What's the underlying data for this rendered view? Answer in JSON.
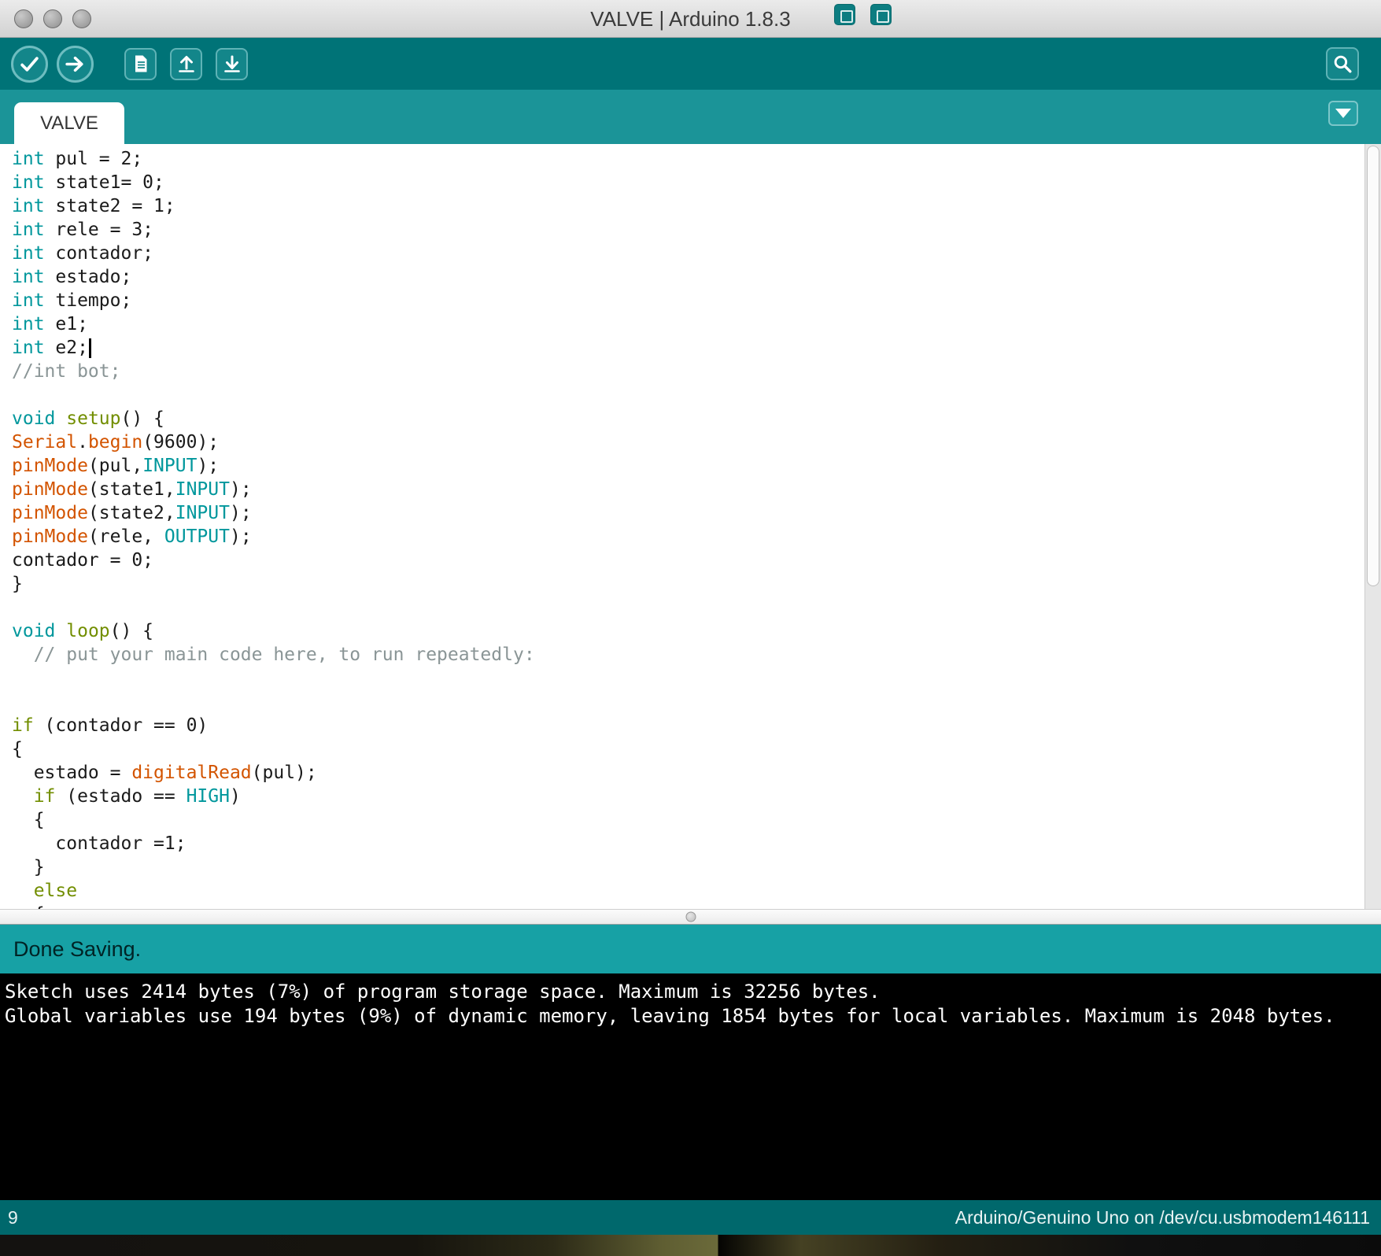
{
  "window": {
    "title": "VALVE | Arduino 1.8.3",
    "traffic_lights": [
      "close",
      "minimize",
      "zoom"
    ]
  },
  "toolbar": {
    "buttons": [
      {
        "label": "Verify",
        "icon": "check-icon"
      },
      {
        "label": "Upload",
        "icon": "arrow-right-icon"
      },
      {
        "label": "New",
        "icon": "document-icon"
      },
      {
        "label": "Open",
        "icon": "arrow-up-icon"
      },
      {
        "label": "Save",
        "icon": "arrow-down-icon"
      }
    ],
    "serial_monitor": {
      "label": "Serial Monitor",
      "icon": "magnifier-icon"
    }
  },
  "tabs": {
    "active": "VALVE",
    "menu_icon": "chevron-down-icon"
  },
  "editor": {
    "caret_line": 9,
    "lines": [
      [
        [
          "k1",
          "int"
        ],
        [
          "pl",
          " pul = 2;"
        ]
      ],
      [
        [
          "k1",
          "int"
        ],
        [
          "pl",
          " state1= 0;"
        ]
      ],
      [
        [
          "k1",
          "int"
        ],
        [
          "pl",
          " state2 = 1;"
        ]
      ],
      [
        [
          "k1",
          "int"
        ],
        [
          "pl",
          " rele = 3;"
        ]
      ],
      [
        [
          "k1",
          "int"
        ],
        [
          "pl",
          " contador;"
        ]
      ],
      [
        [
          "k1",
          "int"
        ],
        [
          "pl",
          " estado;"
        ]
      ],
      [
        [
          "k1",
          "int"
        ],
        [
          "pl",
          " tiempo;"
        ]
      ],
      [
        [
          "k1",
          "int"
        ],
        [
          "pl",
          " e1;"
        ]
      ],
      [
        [
          "k1",
          "int"
        ],
        [
          "pl",
          " e2;"
        ],
        [
          "caret",
          ""
        ]
      ],
      [
        [
          "com",
          "//int bot;"
        ]
      ],
      [],
      [
        [
          "k1",
          "void"
        ],
        [
          "pl",
          " "
        ],
        [
          "k3",
          "setup"
        ],
        [
          "pl",
          "() {"
        ]
      ],
      [
        [
          "k2",
          "Serial"
        ],
        [
          "pl",
          "."
        ],
        [
          "k2",
          "begin"
        ],
        [
          "pl",
          "(9600);"
        ]
      ],
      [
        [
          "k2",
          "pinMode"
        ],
        [
          "pl",
          "(pul,"
        ],
        [
          "k1",
          "INPUT"
        ],
        [
          "pl",
          ");"
        ]
      ],
      [
        [
          "k2",
          "pinMode"
        ],
        [
          "pl",
          "(state1,"
        ],
        [
          "k1",
          "INPUT"
        ],
        [
          "pl",
          ");"
        ]
      ],
      [
        [
          "k2",
          "pinMode"
        ],
        [
          "pl",
          "(state2,"
        ],
        [
          "k1",
          "INPUT"
        ],
        [
          "pl",
          ");"
        ]
      ],
      [
        [
          "k2",
          "pinMode"
        ],
        [
          "pl",
          "(rele, "
        ],
        [
          "k1",
          "OUTPUT"
        ],
        [
          "pl",
          ");"
        ]
      ],
      [
        [
          "pl",
          "contador = 0;"
        ]
      ],
      [
        [
          "pl",
          "}"
        ]
      ],
      [],
      [
        [
          "k1",
          "void"
        ],
        [
          "pl",
          " "
        ],
        [
          "k3",
          "loop"
        ],
        [
          "pl",
          "() {"
        ]
      ],
      [
        [
          "com",
          "  // put your main code here, to run repeatedly:"
        ]
      ],
      [],
      [],
      [
        [
          "k3",
          "if"
        ],
        [
          "pl",
          " (contador == 0)"
        ]
      ],
      [
        [
          "pl",
          "{"
        ]
      ],
      [
        [
          "pl",
          "  estado = "
        ],
        [
          "k2",
          "digitalRead"
        ],
        [
          "pl",
          "(pul);"
        ]
      ],
      [
        [
          "pl",
          "  "
        ],
        [
          "k3",
          "if"
        ],
        [
          "pl",
          " (estado == "
        ],
        [
          "k1",
          "HIGH"
        ],
        [
          "pl",
          ")"
        ]
      ],
      [
        [
          "pl",
          "  {"
        ]
      ],
      [
        [
          "pl",
          "    contador =1;"
        ]
      ],
      [
        [
          "pl",
          "  }"
        ]
      ],
      [
        [
          "pl",
          "  "
        ],
        [
          "k3",
          "else"
        ]
      ],
      [
        [
          "pl",
          "  {"
        ]
      ]
    ]
  },
  "status": {
    "message": "Done Saving."
  },
  "console": {
    "lines": [
      "Sketch uses 2414 bytes (7%) of program storage space. Maximum is 32256 bytes.",
      "Global variables use 194 bytes (9%) of dynamic memory, leaving 1854 bytes for local variables. Maximum is 2048 bytes."
    ]
  },
  "statusline": {
    "line_number": "9",
    "board_info": "Arduino/Genuino Uno on /dev/cu.usbmodem146111"
  },
  "colors": {
    "accent_teal": "#00979C",
    "keyword_function_orange": "#D35400",
    "keyword_control_olive": "#728E00",
    "comment_gray": "#95A5A6",
    "toolbar_teal": "#007377",
    "tabstrip_teal": "#1b9498",
    "status_bar_teal": "#17A1A5",
    "bottom_bar_teal": "#00686c",
    "console_black": "#000000"
  }
}
